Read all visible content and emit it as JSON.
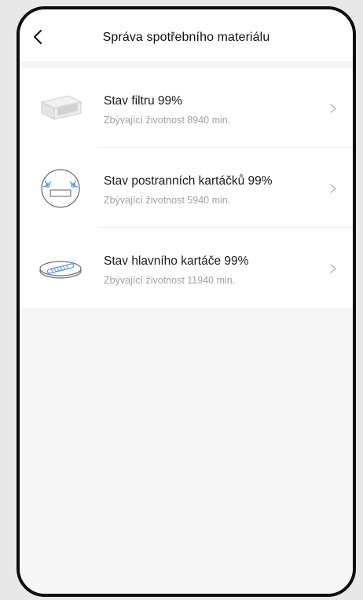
{
  "header": {
    "title": "Správa spotřebního materiálu",
    "back_icon": "chevron-left-icon"
  },
  "consumables": [
    {
      "title": "Stav filtru 99%",
      "subtitle": "Zbývající životnost 8940 min.",
      "icon": "filter-icon"
    },
    {
      "title": "Stav postranních kartáčků 99%",
      "subtitle": "Zbývající životnost 5940 min.",
      "icon": "side-brush-icon"
    },
    {
      "title": "Stav hlavního kartáče 99%",
      "subtitle": "Zbývající životnost 11940 min.",
      "icon": "main-brush-icon"
    }
  ],
  "colors": {
    "accent_blue": "#4a90e2",
    "text_primary": "#1a1a1a",
    "text_secondary": "#a2a2a2"
  }
}
